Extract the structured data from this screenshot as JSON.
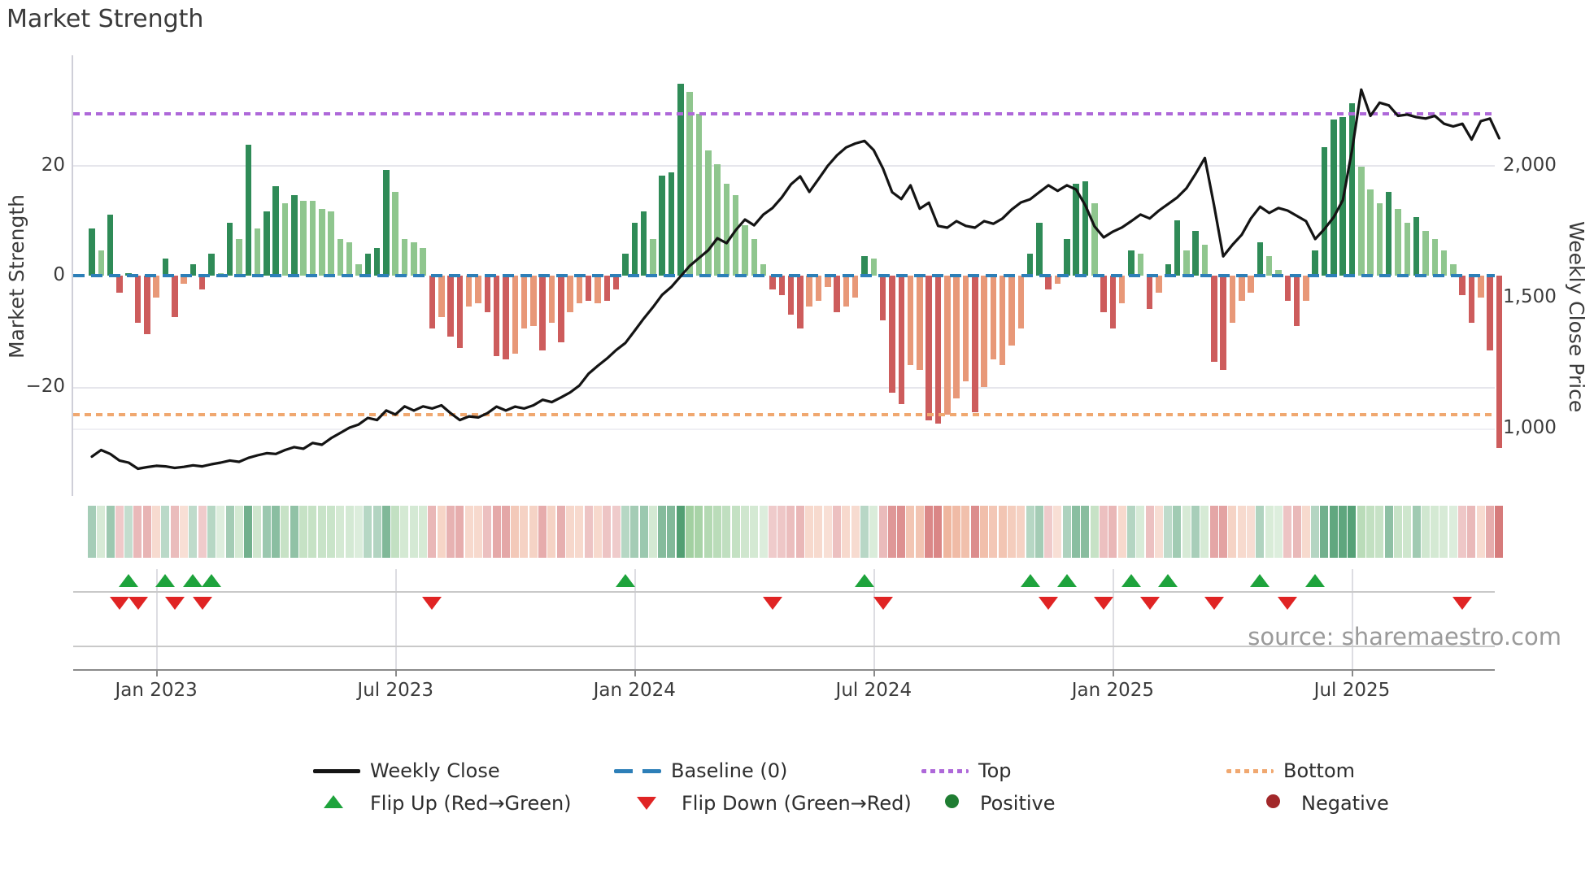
{
  "title": "Market Strength",
  "left_axis": {
    "label": "Market Strength",
    "ticks": [
      "20",
      "0",
      "−20"
    ],
    "tick_values": [
      20,
      0,
      -20
    ]
  },
  "right_axis": {
    "label": "Weekly Close Price",
    "ticks": [
      "2,000",
      "1,500",
      "1,000"
    ],
    "tick_values": [
      2000,
      1500,
      1000
    ]
  },
  "x_axis": {
    "ticks": [
      {
        "label": "Jan 2023",
        "week": 7
      },
      {
        "label": "Jul 2023",
        "week": 33
      },
      {
        "label": "Jan 2024",
        "week": 59
      },
      {
        "label": "Jul 2024",
        "week": 85
      },
      {
        "label": "Jan 2025",
        "week": 111
      },
      {
        "label": "Jul 2025",
        "week": 137
      }
    ]
  },
  "source": "source: sharemaestro.com",
  "legend": {
    "weekly_close": "Weekly Close",
    "baseline": "Baseline (0)",
    "top": "Top",
    "bottom": "Bottom",
    "flip_up": "Flip Up (Red→Green)",
    "flip_down": "Flip Down (Green→Red)",
    "positive": "Positive",
    "negative": "Negative"
  },
  "colors": {
    "positive_dark": "#2f8b57",
    "positive_light": "#8fc68e",
    "negative_dark": "#cd5c5c",
    "negative_light": "#e89878",
    "price_line": "#141414",
    "baseline_blue": "#2d7fb8",
    "top_purple": "#ae68d9",
    "bottom_orange": "#f0a870",
    "flip_up_green": "#1ea33c",
    "flip_down_red": "#e02424",
    "positive_legend_dot": "#1f7d32",
    "negative_legend_dot": "#a2282a"
  },
  "chart_data": {
    "type": "combo",
    "subtype": "weekly bar strength + price line + heatmap strip + flip markers",
    "weeks": 154,
    "x_tick_weeks": [
      7,
      33,
      59,
      85,
      111,
      137
    ],
    "baseline": 0,
    "top_threshold": 29,
    "bottom_threshold": -25,
    "left_ylim": [
      -39,
      39
    ],
    "right_ylim": [
      750,
      2420
    ],
    "grid": "horizontal at 20, -20, 1000",
    "legend_position": "bottom, two rows",
    "strength_values": [
      8.5,
      4.5,
      11,
      -3,
      0.5,
      -8.5,
      -10.5,
      -4,
      3,
      -7.5,
      -1.5,
      2,
      -2.5,
      4,
      0.5,
      9.5,
      6.5,
      23.5,
      8.5,
      11.5,
      16,
      13,
      14.5,
      13.5,
      13.5,
      12,
      11.5,
      6.5,
      6,
      2,
      4,
      5,
      19,
      15,
      6.5,
      6,
      5,
      -9.5,
      -7.5,
      -11,
      -13,
      -5.5,
      -5,
      -6.5,
      -14.5,
      -15,
      -14,
      -9.5,
      -9,
      -13.5,
      -8.5,
      -12,
      -6.5,
      -5,
      -4.5,
      -5,
      -4.5,
      -2.5,
      4,
      9.5,
      11.5,
      6.5,
      18,
      18.5,
      34.5,
      33,
      29,
      22.5,
      20,
      16.5,
      14.5,
      9,
      6.5,
      2,
      -2.5,
      -3.5,
      -7,
      -9.5,
      -5.5,
      -4.5,
      -2,
      -6.5,
      -5.5,
      -4,
      3.5,
      3,
      -8,
      -21,
      -23,
      -16,
      -17,
      -26,
      -26.5,
      -25,
      -22,
      -19,
      -24.5,
      -20,
      -15,
      -16,
      -12.5,
      -9.5,
      4,
      9.5,
      -2.5,
      -1.5,
      6.5,
      16.5,
      17,
      13,
      -6.5,
      -9.5,
      -5,
      4.5,
      4,
      -6,
      -3,
      2,
      10,
      4.5,
      8,
      5.5,
      -15.5,
      -17,
      -8.5,
      -4.5,
      -3,
      6,
      3.5,
      1,
      -4.5,
      -9,
      -4.5,
      4.5,
      23,
      28,
      28.5,
      31,
      19.5,
      15.5,
      13,
      15,
      12,
      9.5,
      10.5,
      8,
      6.5,
      4.5,
      2,
      -3.5,
      -8.5,
      -4,
      -13.5,
      -31
    ],
    "strength_shades": "DLDRDRRSDRSDRDLDLDLDDLDLLLLLLLDDDLLLLRSRRSSRRRSSSRSRSSRSRRDDDLDDDLLLLLLLLLRRRRSSSRSSDLRRRSSRRSSSRSSSSSDDRSDDDLRRSDLRSDDLDLRRSSSDLLRRSDDDDDLLLDLLDLLLLRRSRR",
    "price_values": [
      895,
      920,
      905,
      880,
      872,
      849,
      855,
      860,
      858,
      852,
      856,
      862,
      858,
      866,
      872,
      880,
      875,
      890,
      900,
      908,
      905,
      920,
      931,
      925,
      947,
      940,
      965,
      985,
      1005,
      1017,
      1042,
      1034,
      1070,
      1055,
      1086,
      1070,
      1086,
      1078,
      1090,
      1060,
      1034,
      1048,
      1044,
      1060,
      1085,
      1070,
      1085,
      1078,
      1090,
      1111,
      1102,
      1120,
      1139,
      1165,
      1210,
      1240,
      1268,
      1300,
      1327,
      1373,
      1420,
      1463,
      1510,
      1540,
      1580,
      1620,
      1650,
      1679,
      1725,
      1706,
      1756,
      1796,
      1774,
      1815,
      1840,
      1880,
      1930,
      1960,
      1901,
      1950,
      2000,
      2040,
      2070,
      2085,
      2095,
      2060,
      1990,
      1900,
      1874,
      1926,
      1837,
      1860,
      1772,
      1765,
      1790,
      1772,
      1765,
      1790,
      1780,
      1800,
      1834,
      1861,
      1873,
      1900,
      1926,
      1905,
      1926,
      1910,
      1850,
      1770,
      1728,
      1750,
      1766,
      1790,
      1815,
      1800,
      1830,
      1855,
      1880,
      1915,
      1970,
      2030,
      1850,
      1656,
      1700,
      1738,
      1800,
      1845,
      1821,
      1840,
      1830,
      1810,
      1790,
      1722,
      1760,
      1805,
      1870,
      2060,
      2290,
      2190,
      2240,
      2230,
      2190,
      2195,
      2185,
      2180,
      2190,
      2160,
      2150,
      2160,
      2100,
      2170,
      2180,
      2105
    ],
    "flip_up_weeks": [
      4,
      8,
      11,
      13,
      58,
      84,
      102,
      106,
      113,
      117,
      127,
      133
    ],
    "flip_down_weeks": [
      3,
      5,
      9,
      12,
      37,
      74,
      86,
      104,
      110,
      115,
      122,
      130,
      149
    ]
  }
}
